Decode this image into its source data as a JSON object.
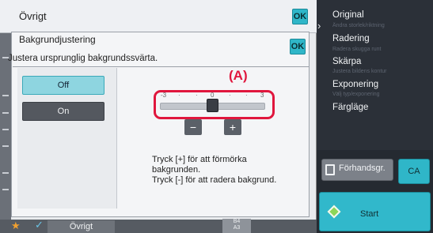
{
  "outer": {
    "title": "Övrigt",
    "ok_label": "OK"
  },
  "dialog": {
    "title": "Bakgrundjustering",
    "ok_label": "OK",
    "description": "Justera ursprunglig bakgrundssvärta.",
    "options": [
      {
        "label": "Off",
        "selected": true
      },
      {
        "label": "On",
        "selected": false
      }
    ],
    "slider": {
      "ticks": [
        "-3",
        "·",
        "·",
        "0",
        "·",
        "·",
        "3"
      ],
      "min": -3,
      "max": 3,
      "value": 0,
      "minus_label": "−",
      "plus_label": "+"
    },
    "callout": "(A)",
    "help_lines": [
      "Tryck [+] för att förmörka",
      "bakgrunden.",
      "Tryck [-] för att radera bakgrund."
    ]
  },
  "bottom_bar": {
    "tab_label": "Övrigt",
    "paper_sizes": [
      "B4",
      "A3"
    ]
  },
  "right_menu": {
    "items": [
      {
        "label": "Original",
        "sub": "Ändra storlek/riktning"
      },
      {
        "label": "Radering",
        "sub": "Radera skugga runt"
      },
      {
        "label": "Skärpa",
        "sub": "Justera bildens kontur"
      },
      {
        "label": "Exponering",
        "sub": "Välj typ/exponering"
      },
      {
        "label": "Färgläge",
        "sub": ""
      }
    ],
    "preview_label": "Förhandsgr.",
    "ca_label": "CA",
    "start_label": "Start"
  },
  "colors": {
    "accent": "#2fb6c8",
    "callout": "#e0163d",
    "selected_option": "#8ed5e0"
  }
}
